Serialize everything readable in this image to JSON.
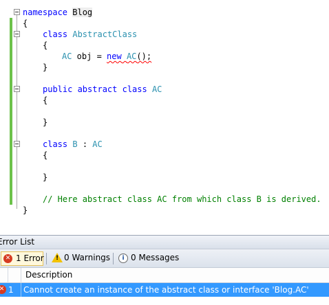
{
  "editor": {
    "lines": [
      [
        "namespace ",
        "Blog"
      ],
      [
        "{"
      ],
      [
        "class ",
        "AbstractClass"
      ],
      [
        "{"
      ],
      [
        "AC",
        " obj = ",
        "new",
        " ",
        "AC",
        "();"
      ],
      [
        "}"
      ],
      [
        ""
      ],
      [
        "public abstract class ",
        "AC"
      ],
      [
        "{"
      ],
      [
        ""
      ],
      [
        "}"
      ],
      [
        ""
      ],
      [
        "class ",
        "B",
        " : ",
        "AC"
      ],
      [
        "{"
      ],
      [
        ""
      ],
      [
        "}"
      ],
      [
        ""
      ],
      [
        "// Here abstract class AC from which class B is derived."
      ],
      [
        "}"
      ]
    ]
  },
  "error_list": {
    "title": "Error List",
    "errors_button": "1 Error",
    "warnings_button": "0 Warnings",
    "messages_button": "0 Messages",
    "columns": [
      "Description"
    ],
    "rows": [
      {
        "number": "1",
        "description": "Cannot create an instance of the abstract class or interface 'Blog.AC'"
      }
    ]
  },
  "icons": {
    "error": "error-icon",
    "warning": "warning-icon",
    "info": "info-icon",
    "fold": "collapse-icon"
  },
  "colors": {
    "keyword": "#0000ff",
    "type": "#2b91af",
    "comment": "#008000",
    "change_bar": "#6cc24a",
    "selection": "#3399ff"
  }
}
